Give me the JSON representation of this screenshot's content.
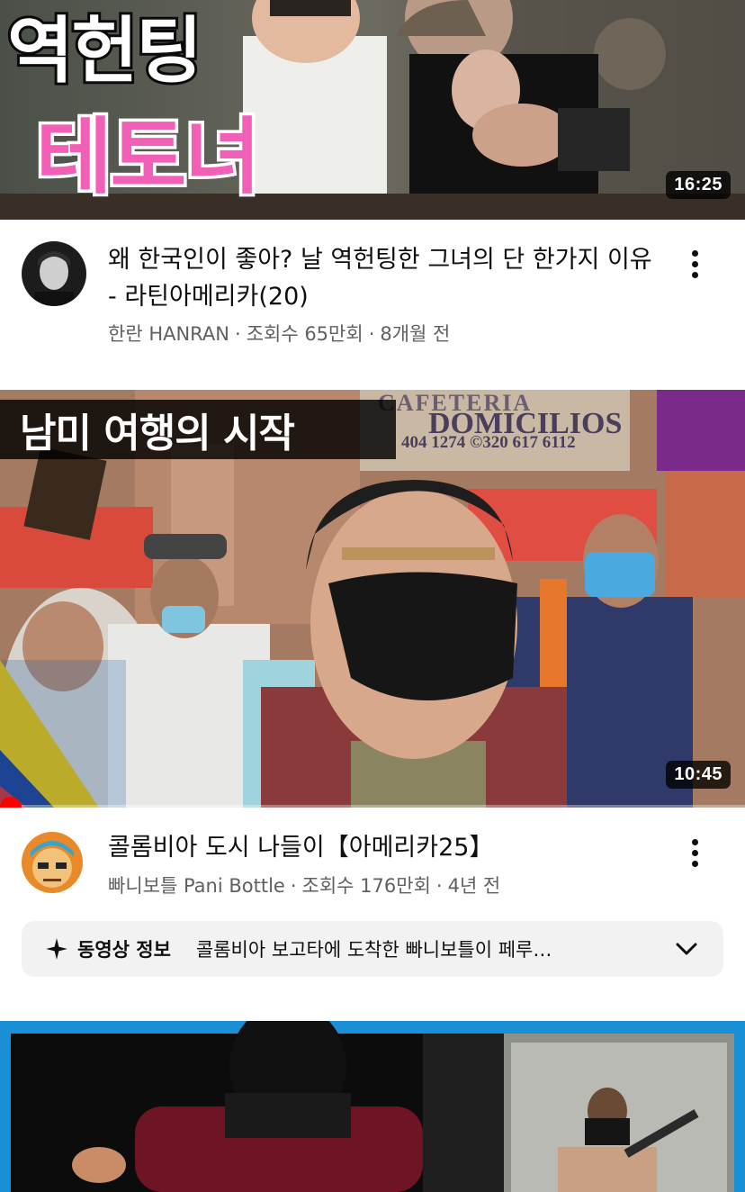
{
  "videos": [
    {
      "thumb_text_line1": "역헌팅",
      "thumb_text_line2": "테토녀",
      "duration": "16:25",
      "title": "왜 한국인이 좋아? 날 역헌팅한 그녀의 단 한가지 이유 - 라틴아메리카(20)",
      "channel": "한란 HANRAN",
      "views": "조회수 65만회",
      "age": "8개월 전"
    },
    {
      "thumb_caption": "남미 여행의 시작",
      "sign_text": "DOMICILIOS",
      "sign_top": "CAFETERIA",
      "sign_phone": "404 1274 ©320 617 6112",
      "duration": "10:45",
      "progress": 0.01,
      "title": "콜롬비아 도시 나들이【아메리카25】",
      "channel": "빠니보틀 Pani Bottle",
      "views": "조회수 176만회",
      "age": "4년 전",
      "info_label": "동영상 정보",
      "info_text": "콜롬비아 보고타에 도착한 빠니보틀이 페루…"
    }
  ],
  "separator": "·",
  "colors": {
    "accent_red": "#ff0000",
    "thumb_pink": "#f15fb6",
    "frame_blue": "#1b8fd6"
  }
}
